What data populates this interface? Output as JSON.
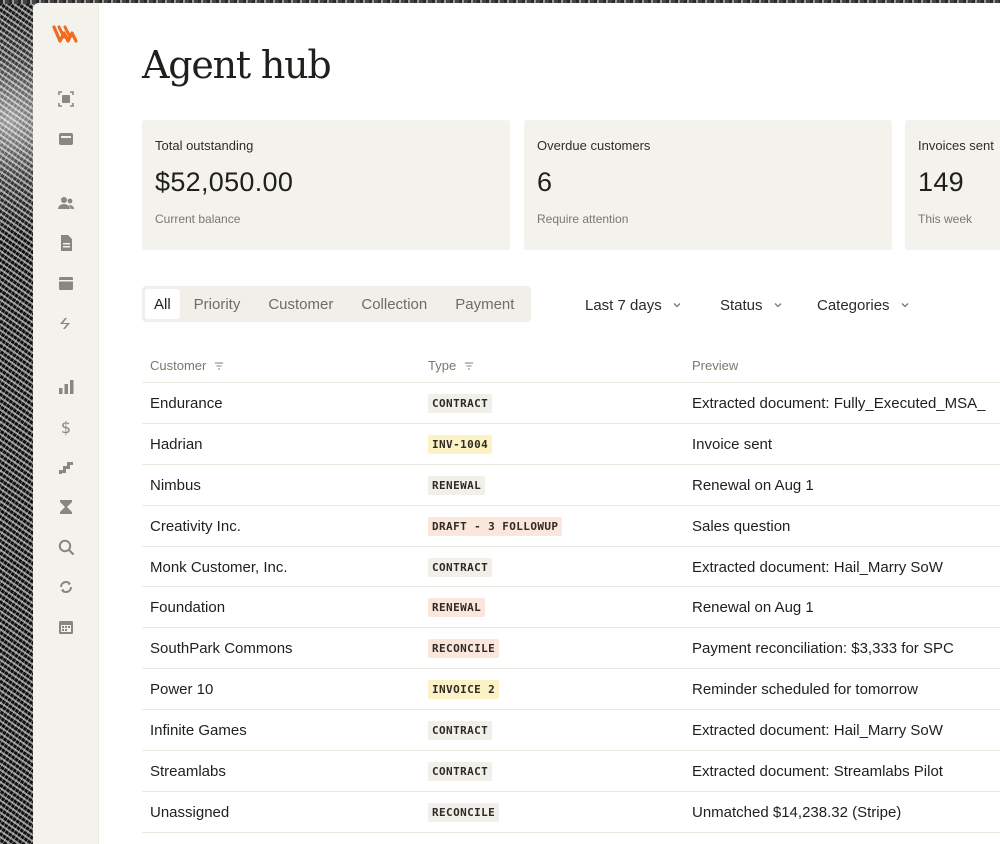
{
  "page": {
    "title": "Agent hub"
  },
  "colors": {
    "brand": "#f26a1b",
    "badge_neutral": "#f1efe9",
    "badge_yellow": "#fdf1c6",
    "badge_peach": "#fbe6dc"
  },
  "sidebar": {
    "logo": "brand-logo-icon",
    "items": [
      {
        "icon": "scan-document-icon"
      },
      {
        "icon": "inbox-icon"
      },
      {
        "icon": "users-icon"
      },
      {
        "icon": "document-icon"
      },
      {
        "icon": "store-icon"
      },
      {
        "icon": "transfer-icon"
      },
      {
        "icon": "bar-chart-icon"
      },
      {
        "icon": "dollar-icon"
      },
      {
        "icon": "stairs-icon"
      },
      {
        "icon": "hourglass-icon"
      },
      {
        "icon": "search-icon"
      },
      {
        "icon": "refresh-icon"
      },
      {
        "icon": "calendar-icon"
      }
    ]
  },
  "stats": [
    {
      "label": "Total outstanding",
      "value": "$52,050.00",
      "sub": "Current balance"
    },
    {
      "label": "Overdue customers",
      "value": "6",
      "sub": "Require attention"
    },
    {
      "label": "Invoices sent",
      "value": "149",
      "sub": "This week"
    }
  ],
  "filters": {
    "tabs": [
      "All",
      "Priority",
      "Customer",
      "Collection",
      "Payment"
    ],
    "active_tab": "All",
    "date_range": "Last 7 days",
    "status": "Status",
    "categories": "Categories"
  },
  "table": {
    "columns": {
      "customer": "Customer",
      "type": "Type",
      "preview": "Preview"
    },
    "rows": [
      {
        "customer": "Endurance",
        "type": "CONTRACT",
        "tone": "neutral",
        "preview": "Extracted document: Fully_Executed_MSA_"
      },
      {
        "customer": "Hadrian",
        "type": "INV-1004",
        "tone": "yellow",
        "preview": "Invoice sent"
      },
      {
        "customer": "Nimbus",
        "type": "RENEWAL",
        "tone": "neutral",
        "preview": "Renewal on Aug 1"
      },
      {
        "customer": "Creativity Inc.",
        "type": "DRAFT - 3 FOLLOWUP",
        "tone": "peach",
        "preview": "Sales question"
      },
      {
        "customer": "Monk Customer, Inc.",
        "type": "CONTRACT",
        "tone": "neutral",
        "preview": "Extracted document: Hail_Marry SoW"
      },
      {
        "customer": "Foundation",
        "type": "RENEWAL",
        "tone": "peach",
        "preview": "Renewal on Aug 1"
      },
      {
        "customer": "SouthPark Commons",
        "type": "RECONCILE",
        "tone": "peach",
        "preview": "Payment reconciliation: $3,333 for SPC"
      },
      {
        "customer": "Power 10",
        "type": "INVOICE 2",
        "tone": "yellow",
        "preview": "Reminder scheduled for tomorrow"
      },
      {
        "customer": "Infinite Games",
        "type": "CONTRACT",
        "tone": "neutral",
        "preview": "Extracted document: Hail_Marry SoW"
      },
      {
        "customer": "Streamlabs",
        "type": "CONTRACT",
        "tone": "neutral",
        "preview": "Extracted document: Streamlabs Pilot"
      },
      {
        "customer": "Unassigned",
        "type": "RECONCILE",
        "tone": "neutral",
        "preview": "Unmatched $14,238.32 (Stripe)"
      }
    ]
  }
}
